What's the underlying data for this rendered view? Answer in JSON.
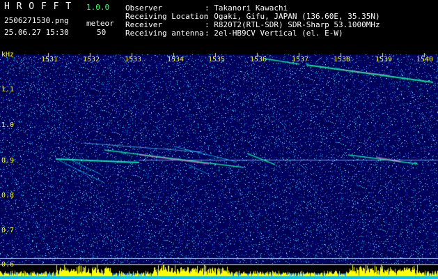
{
  "app": {
    "name": "H R O F F T",
    "version": "1.0.0",
    "filename": "2506271530.png",
    "datetime": "25.06.27 15:30",
    "meteor_label": "meteor",
    "meteor_count": "50"
  },
  "station": {
    "observer_label": "Observer",
    "observer_value": ": Takanori Kawachi",
    "location_label": "Receiving Location",
    "location_value": ": Ogaki, Gifu, JAPAN (136.60E, 35.35N)",
    "receiver_label": "Receiver",
    "receiver_value": ": R820T2(RTL-SDR) SDR-Sharp 53.1000MHz",
    "antenna_label": "Receiving antenna",
    "antenna_value": ": 2el-HB9CV Vertical (el. E-W)"
  },
  "axes": {
    "unit": "kHz",
    "x_ticks": [
      "1531",
      "1532",
      "1533",
      "1534",
      "1535",
      "1536",
      "1537",
      "1538",
      "1539",
      "1540"
    ],
    "y_ticks": [
      "1.1",
      "1.0",
      "0.9",
      "0.8",
      "0.7",
      "0.6"
    ]
  },
  "colors": {
    "background": "#000000",
    "noise_base": "#00107a",
    "header_white": "#ffffff",
    "header_yellow": "#ffff00",
    "signal_green": "#00ff88",
    "activity_bar": "#ffff00",
    "activity_base": "#00a0ff"
  }
}
